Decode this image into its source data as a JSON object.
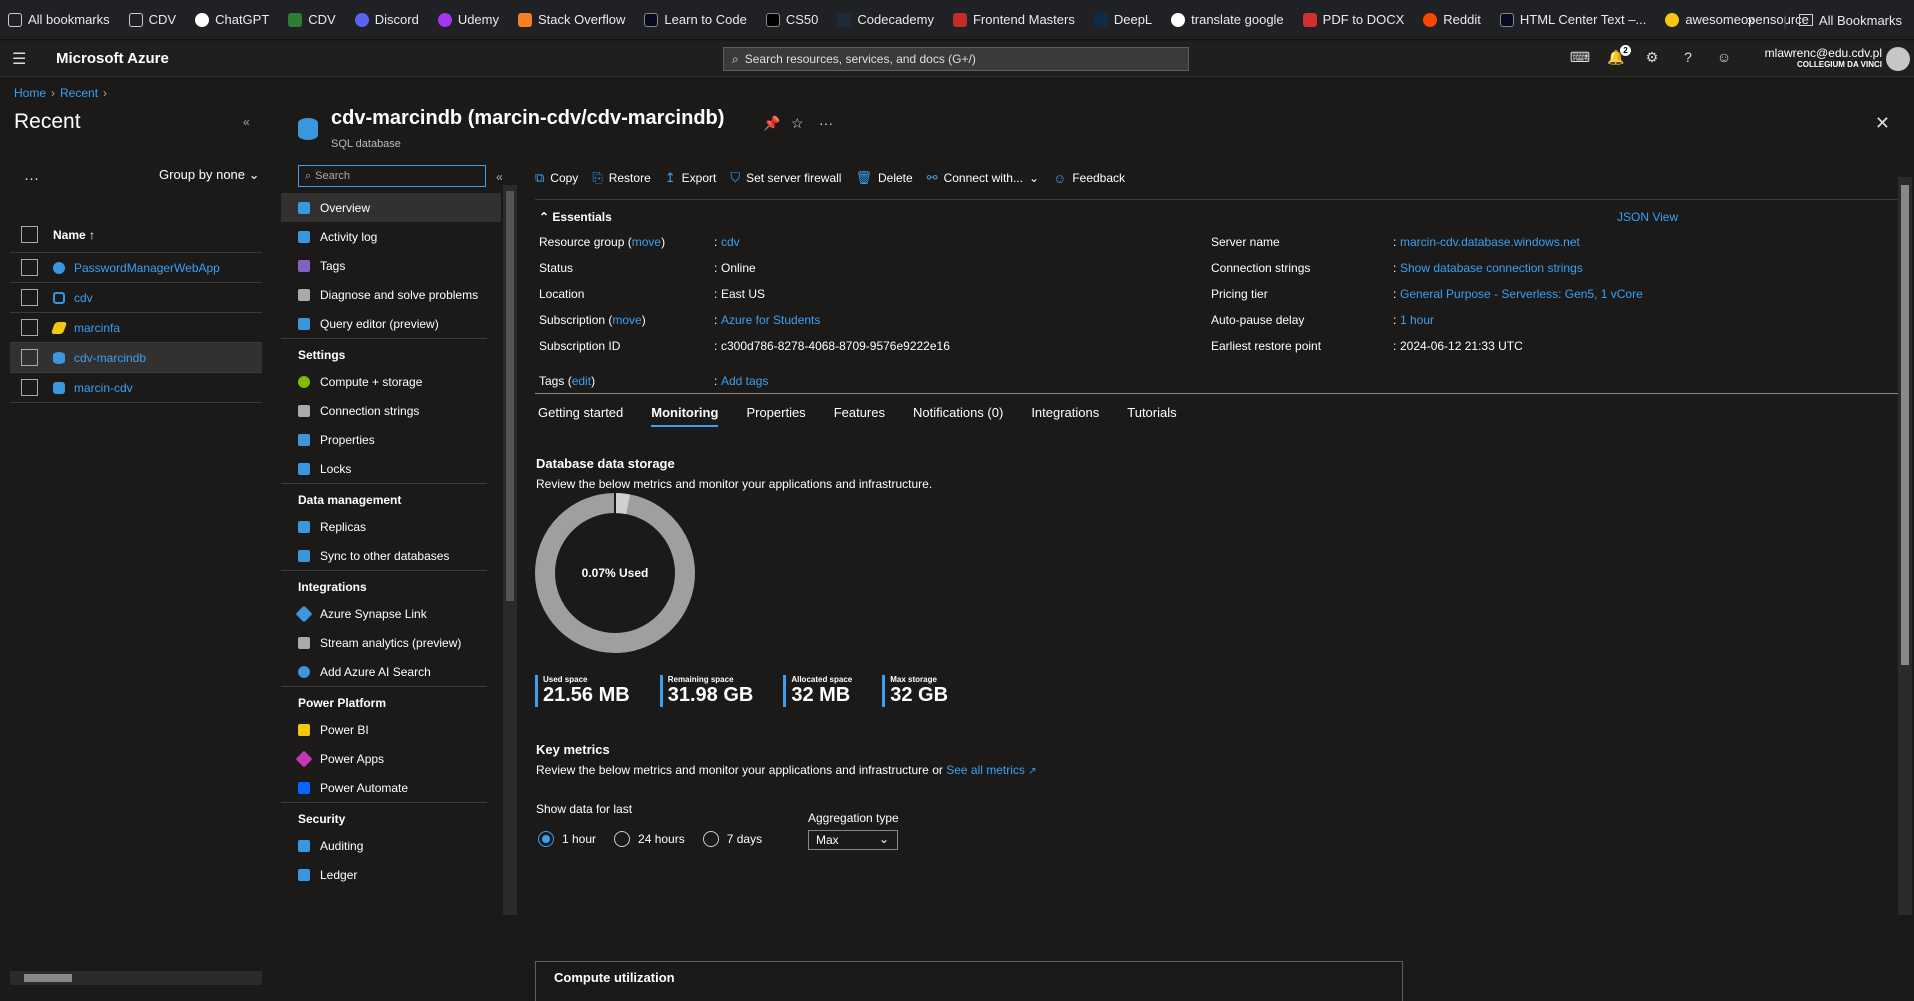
{
  "bookmarks": {
    "items": [
      "All bookmarks",
      "CDV",
      "ChatGPT",
      "CDV",
      "Discord",
      "Udemy",
      "Stack Overflow",
      "Learn to Code",
      "CS50",
      "Codecademy",
      "Frontend Masters",
      "DeepL",
      "translate google",
      "PDF to DOCX",
      "Reddit",
      "HTML Center Text –...",
      "awesomeopensource"
    ],
    "overflow": "»",
    "right": "All Bookmarks"
  },
  "topbar": {
    "brand": "Microsoft Azure",
    "search_placeholder": "Search resources, services, and docs (G+/)",
    "notifications_count": "2",
    "user_email": "mlawrenc@edu.cdv.pl",
    "user_org": "COLLEGIUM DA VINCI"
  },
  "breadcrumb": {
    "home": "Home",
    "recent": "Recent"
  },
  "left": {
    "title": "Recent",
    "group_by": "Group by none",
    "column_name": "Name ↑",
    "items": [
      {
        "name": "PasswordManagerWebApp",
        "color": "#3a96dd"
      },
      {
        "name": "cdv",
        "color": "#3a96dd"
      },
      {
        "name": "marcinfa",
        "color": "#f2c811"
      },
      {
        "name": "cdv-marcindb",
        "color": "#3a96dd"
      },
      {
        "name": "marcin-cdv",
        "color": "#3a96dd"
      }
    ]
  },
  "resource": {
    "title": "cdv-marcindb (marcin-cdv/cdv-marcindb)",
    "subtitle": "SQL database"
  },
  "menu": {
    "search_placeholder": "Search",
    "top": [
      "Overview",
      "Activity log",
      "Tags",
      "Diagnose and solve problems",
      "Query editor (preview)"
    ],
    "settings_header": "Settings",
    "settings": [
      "Compute + storage",
      "Connection strings",
      "Properties",
      "Locks"
    ],
    "data_header": "Data management",
    "data": [
      "Replicas",
      "Sync to other databases"
    ],
    "integrations_header": "Integrations",
    "integrations": [
      "Azure Synapse Link",
      "Stream analytics (preview)",
      "Add Azure AI Search"
    ],
    "power_header": "Power Platform",
    "power": [
      "Power BI",
      "Power Apps",
      "Power Automate"
    ],
    "security_header": "Security",
    "security": [
      "Auditing",
      "Ledger"
    ]
  },
  "commands": [
    "Copy",
    "Restore",
    "Export",
    "Set server firewall",
    "Delete",
    "Connect with...",
    "Feedback"
  ],
  "essentials": {
    "header": "Essentials",
    "json_view": "JSON View",
    "left": [
      {
        "key": "Resource group",
        "link": "move",
        "value": "cdv",
        "value_link": true
      },
      {
        "key": "Status",
        "value": "Online"
      },
      {
        "key": "Location",
        "value": "East US"
      },
      {
        "key": "Subscription",
        "link": "move",
        "value": "Azure for Students",
        "value_link": true
      },
      {
        "key": "Subscription ID",
        "value": "c300d786-8278-4068-8709-9576e9222e16"
      }
    ],
    "right": [
      {
        "key": "Server name",
        "value": "marcin-cdv.database.windows.net",
        "value_link": true
      },
      {
        "key": "Connection strings",
        "value": "Show database connection strings"
      },
      {
        "key": "Pricing tier",
        "value": "General Purpose - Serverless: Gen5, 1 vCore"
      },
      {
        "key": "Auto-pause delay",
        "value": "1 hour"
      },
      {
        "key": "Earliest restore point",
        "value": "2024-06-12 21:33 UTC"
      }
    ],
    "tags_key": "Tags",
    "tags_edit": "edit",
    "tags_value": "Add tags"
  },
  "tabs": [
    "Getting started",
    "Monitoring",
    "Properties",
    "Features",
    "Notifications (0)",
    "Integrations",
    "Tutorials"
  ],
  "storage": {
    "title": "Database data storage",
    "description": "Review the below metrics and monitor your applications and infrastructure.",
    "used_label": "0.07% Used",
    "used_fraction": 0.0007,
    "stats": [
      {
        "label": "Used space",
        "value": "21.56 MB"
      },
      {
        "label": "Remaining space",
        "value": "31.98 GB"
      },
      {
        "label": "Allocated space",
        "value": "32 MB"
      },
      {
        "label": "Max storage",
        "value": "32 GB"
      }
    ]
  },
  "key_metrics": {
    "title": "Key metrics",
    "description": "Review the below metrics and monitor your applications and infrastructure or",
    "link": "See all metrics",
    "show_data": "Show data for last",
    "options": [
      "1 hour",
      "24 hours",
      "7 days"
    ],
    "selected": "1 hour",
    "aggregation_label": "Aggregation type",
    "aggregation_value": "Max",
    "compute": "Compute utilization"
  }
}
